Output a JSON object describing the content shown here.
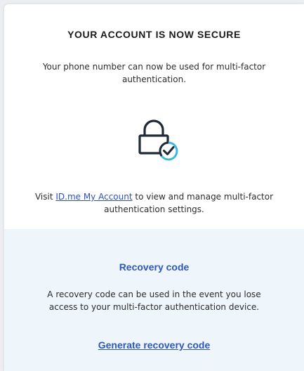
{
  "header": {
    "title": "YOUR ACCOUNT IS NOW SECURE",
    "subtitle": "Your phone number can now be used for multi-factor authentication."
  },
  "icon": {
    "name": "lock-check-icon",
    "stroke_color": "#1f2937",
    "check_color": "#3bb9dd"
  },
  "account_info": {
    "prefix": "Visit ",
    "link_text": "ID.me My Account",
    "suffix": " to view and manage multi-factor authentication settings."
  },
  "recovery": {
    "title": "Recovery code",
    "description": "A recovery code can be used in the event you lose access to your multi-factor authentication device.",
    "action_label": "Generate recovery code"
  },
  "colors": {
    "accent": "#2e57b8",
    "link": "#2c4ec7",
    "recovery_background": "#eef5fb"
  }
}
